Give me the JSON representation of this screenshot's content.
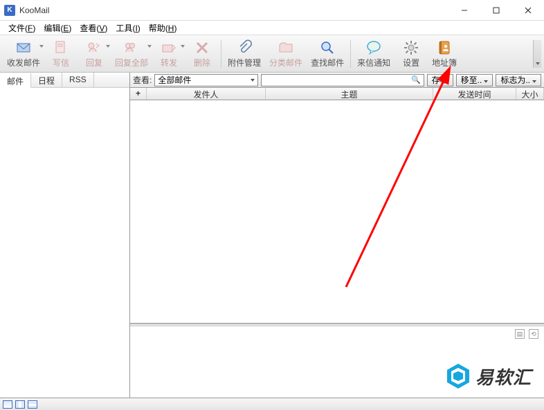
{
  "app": {
    "title": "KooMail"
  },
  "menubar": [
    {
      "label": "文件",
      "key": "F"
    },
    {
      "label": "编辑",
      "key": "E"
    },
    {
      "label": "查看",
      "key": "V"
    },
    {
      "label": "工具",
      "key": "I"
    },
    {
      "label": "帮助",
      "key": "H"
    }
  ],
  "toolbar": {
    "receive": "收发邮件",
    "compose": "写信",
    "reply": "回复",
    "replyall": "回复全部",
    "forward": "转发",
    "delete": "删除",
    "attach": "附件管理",
    "categorize": "分类邮件",
    "find": "查找邮件",
    "notify": "来信通知",
    "settings": "设置",
    "address": "地址簿"
  },
  "lefttabs": {
    "mail": "邮件",
    "calendar": "日程",
    "rss": "RSS"
  },
  "filterbar": {
    "view_label": "查看:",
    "view_value": "全部邮件",
    "archive": "存档",
    "moveto": "移至..",
    "flagas": "标志为.."
  },
  "columns": {
    "att": "+",
    "from": "发件人",
    "subject": "主题",
    "date": "发送时间",
    "size": "大小"
  },
  "watermark": "易软汇"
}
